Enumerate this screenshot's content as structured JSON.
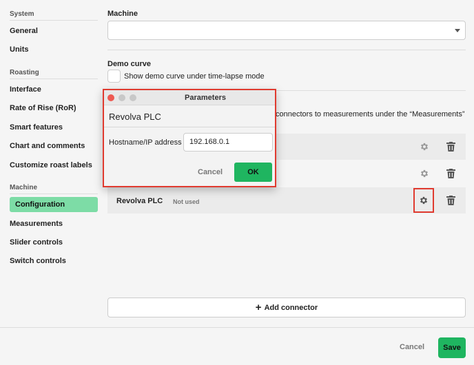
{
  "sidebar": {
    "sections": [
      {
        "title": "System",
        "items": [
          {
            "label": "General"
          },
          {
            "label": "Units"
          }
        ]
      },
      {
        "title": "Roasting",
        "items": [
          {
            "label": "Interface"
          },
          {
            "label": "Rate of Rise (RoR)"
          },
          {
            "label": "Smart features"
          },
          {
            "label": "Chart and comments"
          },
          {
            "label": "Customize roast labels"
          }
        ]
      },
      {
        "title": "Machine",
        "items": [
          {
            "label": "Configuration",
            "active": true
          },
          {
            "label": "Measurements"
          },
          {
            "label": "Slider controls"
          },
          {
            "label": "Switch controls"
          }
        ]
      }
    ]
  },
  "main": {
    "machine_label": "Machine",
    "machine_value": "",
    "demo_curve_label": "Demo curve",
    "demo_curve_checkbox_label": "Show demo curve under time-lapse mode",
    "demo_curve_checked": false,
    "hint_text": "connectors to measurements under the “Measurements”",
    "connectors": [
      {
        "name": "",
        "status": ""
      },
      {
        "name": "",
        "status": ""
      },
      {
        "name": "Revolva PLC",
        "status": "Not used"
      }
    ],
    "add_connector_label": "Add connector"
  },
  "footer": {
    "cancel_label": "Cancel",
    "save_label": "Save"
  },
  "dialog": {
    "window_title": "Parameters",
    "heading": "Revolva PLC",
    "hostname_label": "Hostname/IP address",
    "hostname_value": "192.168.0.1",
    "cancel_label": "Cancel",
    "ok_label": "OK"
  },
  "colors": {
    "accent": "#1fb560",
    "active_nav": "#7ddca6",
    "highlight": "#e03a2f",
    "close_dot": "#ee5a52",
    "inactive_dot": "#c8c8c8"
  }
}
